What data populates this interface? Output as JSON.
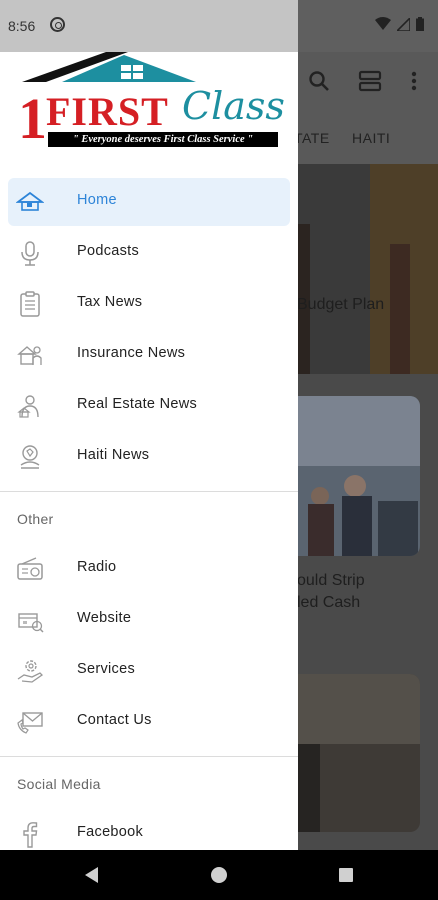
{
  "status_bar": {
    "time": "8:56"
  },
  "background": {
    "tabs": [
      "TATE",
      "HAITI"
    ],
    "cards": [
      {
        "title": "Budget Plan"
      },
      {
        "title_line1": "ould Strip",
        "title_line2": "led Cash"
      }
    ]
  },
  "logo": {
    "one": "1",
    "first": "FIRST",
    "class": "Class",
    "tagline": "\" Everyone deserves First Class Service \""
  },
  "colors": {
    "accent": "#2d84d8",
    "active_bg": "#e7f1fb",
    "logo_red": "#d51f24",
    "logo_teal": "#1d8fa0"
  },
  "drawer": {
    "main_items": [
      {
        "label": "Home",
        "icon": "house-icon",
        "active": true
      },
      {
        "label": "Podcasts",
        "icon": "microphone-icon"
      },
      {
        "label": "Tax News",
        "icon": "clipboard-icon"
      },
      {
        "label": "Insurance News",
        "icon": "insurance-icon"
      },
      {
        "label": "Real Estate News",
        "icon": "realtor-icon"
      },
      {
        "label": "Haiti News",
        "icon": "haiti-icon"
      }
    ],
    "other_label": "Other",
    "other_items": [
      {
        "label": "Radio",
        "icon": "radio-icon"
      },
      {
        "label": "Website",
        "icon": "website-icon"
      },
      {
        "label": "Services",
        "icon": "services-icon"
      },
      {
        "label": "Contact Us",
        "icon": "mail-icon"
      }
    ],
    "social_label": "Social Media",
    "social_items": [
      {
        "label": "Facebook",
        "icon": "facebook-icon"
      }
    ]
  }
}
